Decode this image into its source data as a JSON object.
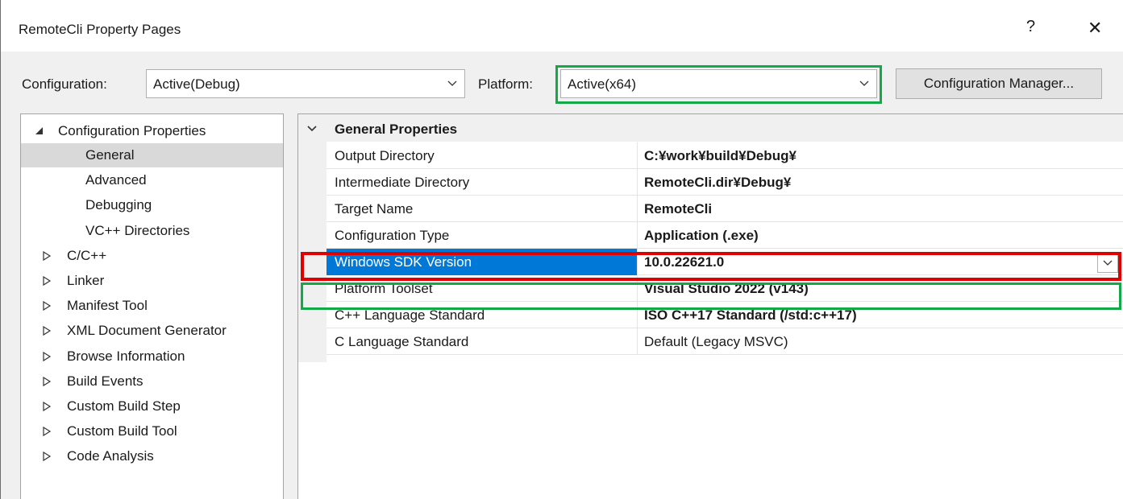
{
  "window": {
    "title": "RemoteCli Property Pages",
    "help_glyph": "?",
    "close_glyph": "✕"
  },
  "toolbar": {
    "configuration_label": "Configuration:",
    "configuration_value": "Active(Debug)",
    "platform_label": "Platform:",
    "platform_value": "Active(x64)",
    "config_manager_label": "Configuration Manager..."
  },
  "tree": {
    "root": "Configuration Properties",
    "items": [
      {
        "label": "General",
        "expandable": false,
        "selected": true
      },
      {
        "label": "Advanced",
        "expandable": false
      },
      {
        "label": "Debugging",
        "expandable": false
      },
      {
        "label": "VC++ Directories",
        "expandable": false
      },
      {
        "label": "C/C++",
        "expandable": true
      },
      {
        "label": "Linker",
        "expandable": true
      },
      {
        "label": "Manifest Tool",
        "expandable": true
      },
      {
        "label": "XML Document Generator",
        "expandable": true
      },
      {
        "label": "Browse Information",
        "expandable": true
      },
      {
        "label": "Build Events",
        "expandable": true
      },
      {
        "label": "Custom Build Step",
        "expandable": true
      },
      {
        "label": "Custom Build Tool",
        "expandable": true
      },
      {
        "label": "Code Analysis",
        "expandable": true
      }
    ]
  },
  "grid": {
    "group_label": "General Properties",
    "rows": [
      {
        "name": "Output Directory",
        "value": "C:¥work¥build¥Debug¥"
      },
      {
        "name": "Intermediate Directory",
        "value": "RemoteCli.dir¥Debug¥"
      },
      {
        "name": "Target Name",
        "value": "RemoteCli"
      },
      {
        "name": "Configuration Type",
        "value": "Application (.exe)"
      },
      {
        "name": "Windows SDK Version",
        "value": "10.0.22621.0"
      },
      {
        "name": "Platform Toolset",
        "value": "Visual Studio 2022 (v143)"
      },
      {
        "name": "C++ Language Standard",
        "value": "ISO C++17 Standard (/std:c++17)"
      },
      {
        "name": "C Language Standard",
        "value": "Default (Legacy MSVC)"
      }
    ]
  },
  "highlight_colors": {
    "green": "#13a848",
    "red": "#e00000",
    "selection": "#0078d7"
  }
}
